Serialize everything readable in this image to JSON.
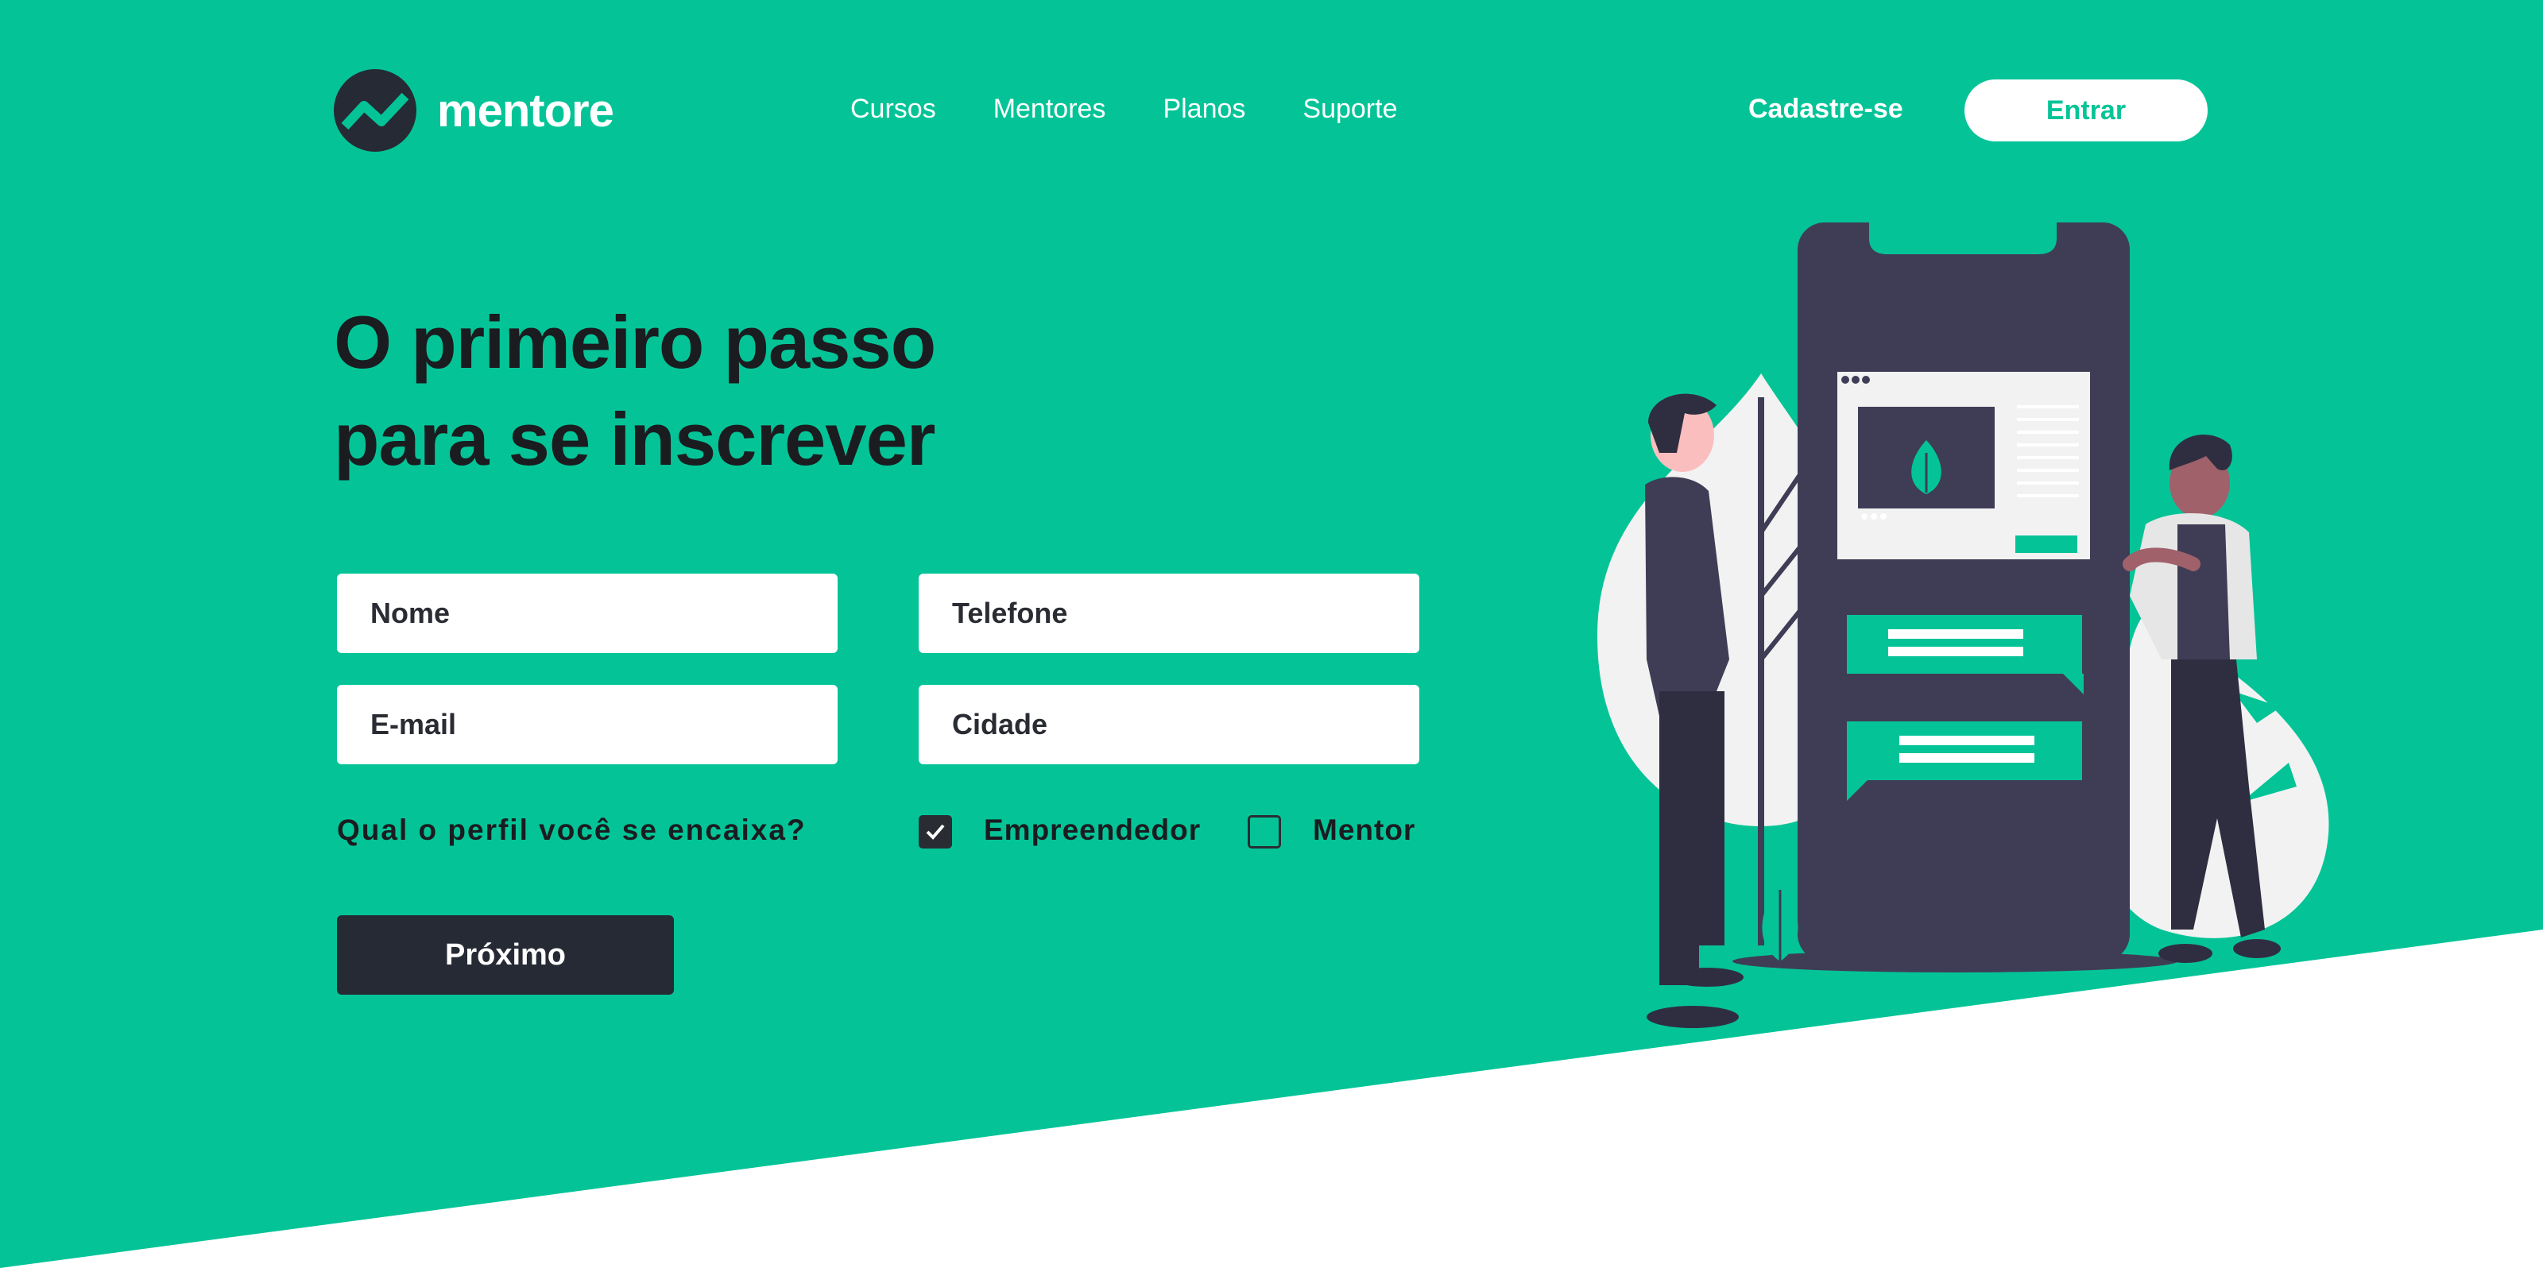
{
  "header": {
    "brand": "mentore",
    "nav": [
      "Cursos",
      "Mentores",
      "Planos",
      "Suporte"
    ],
    "signup_label": "Cadastre-se",
    "login_label": "Entrar"
  },
  "hero": {
    "title_line1": "O primeiro passo",
    "title_line2": "para se inscrever"
  },
  "form": {
    "name_placeholder": "Nome",
    "phone_placeholder": "Telefone",
    "email_placeholder": "E-mail",
    "city_placeholder": "Cidade",
    "profile_question": "Qual o perfil você se encaixa?",
    "options": [
      {
        "label": "Empreendedor",
        "checked": true
      },
      {
        "label": "Mentor",
        "checked": false
      }
    ],
    "next_label": "Próximo"
  },
  "colors": {
    "brand_green": "#04c497",
    "dark": "#262a35",
    "white": "#ffffff"
  }
}
